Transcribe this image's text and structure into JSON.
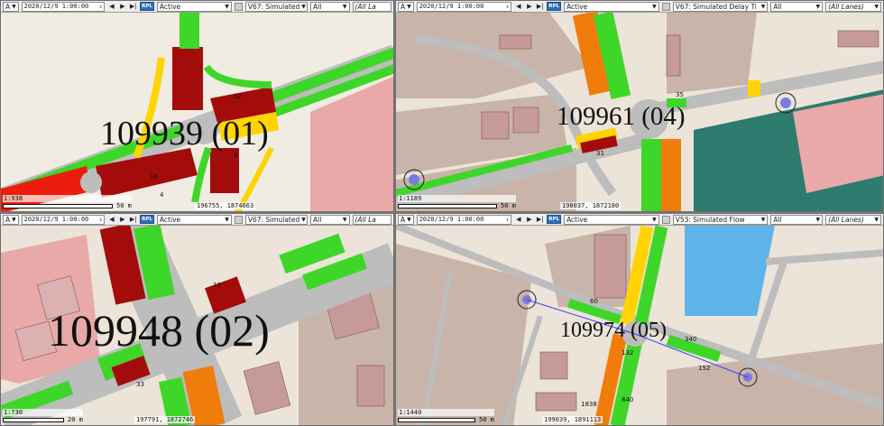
{
  "panes": [
    {
      "date": "2020/12/9 1:00:00",
      "mode": "Active",
      "attr": "V67: Simulated",
      "filter": "All",
      "lanes": "(All La",
      "id_text": "109939 (01)",
      "ratio": "1:938",
      "scale_len": "50 m",
      "coords": "196755, 1874663"
    },
    {
      "date": "2020/12/9 1:00:00",
      "mode": "Active",
      "attr": "V67: Simulated Delay Ti",
      "filter": "All",
      "lanes": "(All Lanes)",
      "id_text": "109961 (04)",
      "ratio": "1:1189",
      "scale_len": "50 m",
      "coords": "198037, 1872180"
    },
    {
      "date": "2020/12/9 1:00:00",
      "mode": "Active",
      "attr": "V67: Simulated",
      "filter": "All",
      "lanes": "(All La",
      "id_text": "109948 (02)",
      "ratio": "1:730",
      "scale_len": "20 m",
      "coords": "197791, 1872746"
    },
    {
      "date": "2020/12/9 1:00:00",
      "mode": "Active",
      "attr": "V53: Simulated Flow",
      "filter": "All",
      "lanes": "(All Lanes)",
      "id_text": "109974 (05)",
      "ratio": "1:1440",
      "scale_len": "50 m",
      "coords": "199039, 1891113"
    }
  ],
  "toolbar": {
    "a_label": "A",
    "rpl_label": "RPL"
  },
  "link_labels": {
    "p1": [
      "12",
      "16",
      "4",
      "3"
    ],
    "p2": [
      "35",
      "31"
    ],
    "p3": [
      "10",
      "33"
    ],
    "p4": [
      "60",
      "340",
      "152",
      "132",
      "1838",
      "840"
    ]
  },
  "colors": {
    "green": "#3fd62a",
    "dark_red": "#a40c0c",
    "red": "#ee1c0c",
    "yellow": "#ffd400",
    "orange": "#f07c0a",
    "gray_road": "#bdbdbd",
    "building": "#c8b4a8",
    "teal": "#2e7b70",
    "water": "#5fb3e8"
  }
}
